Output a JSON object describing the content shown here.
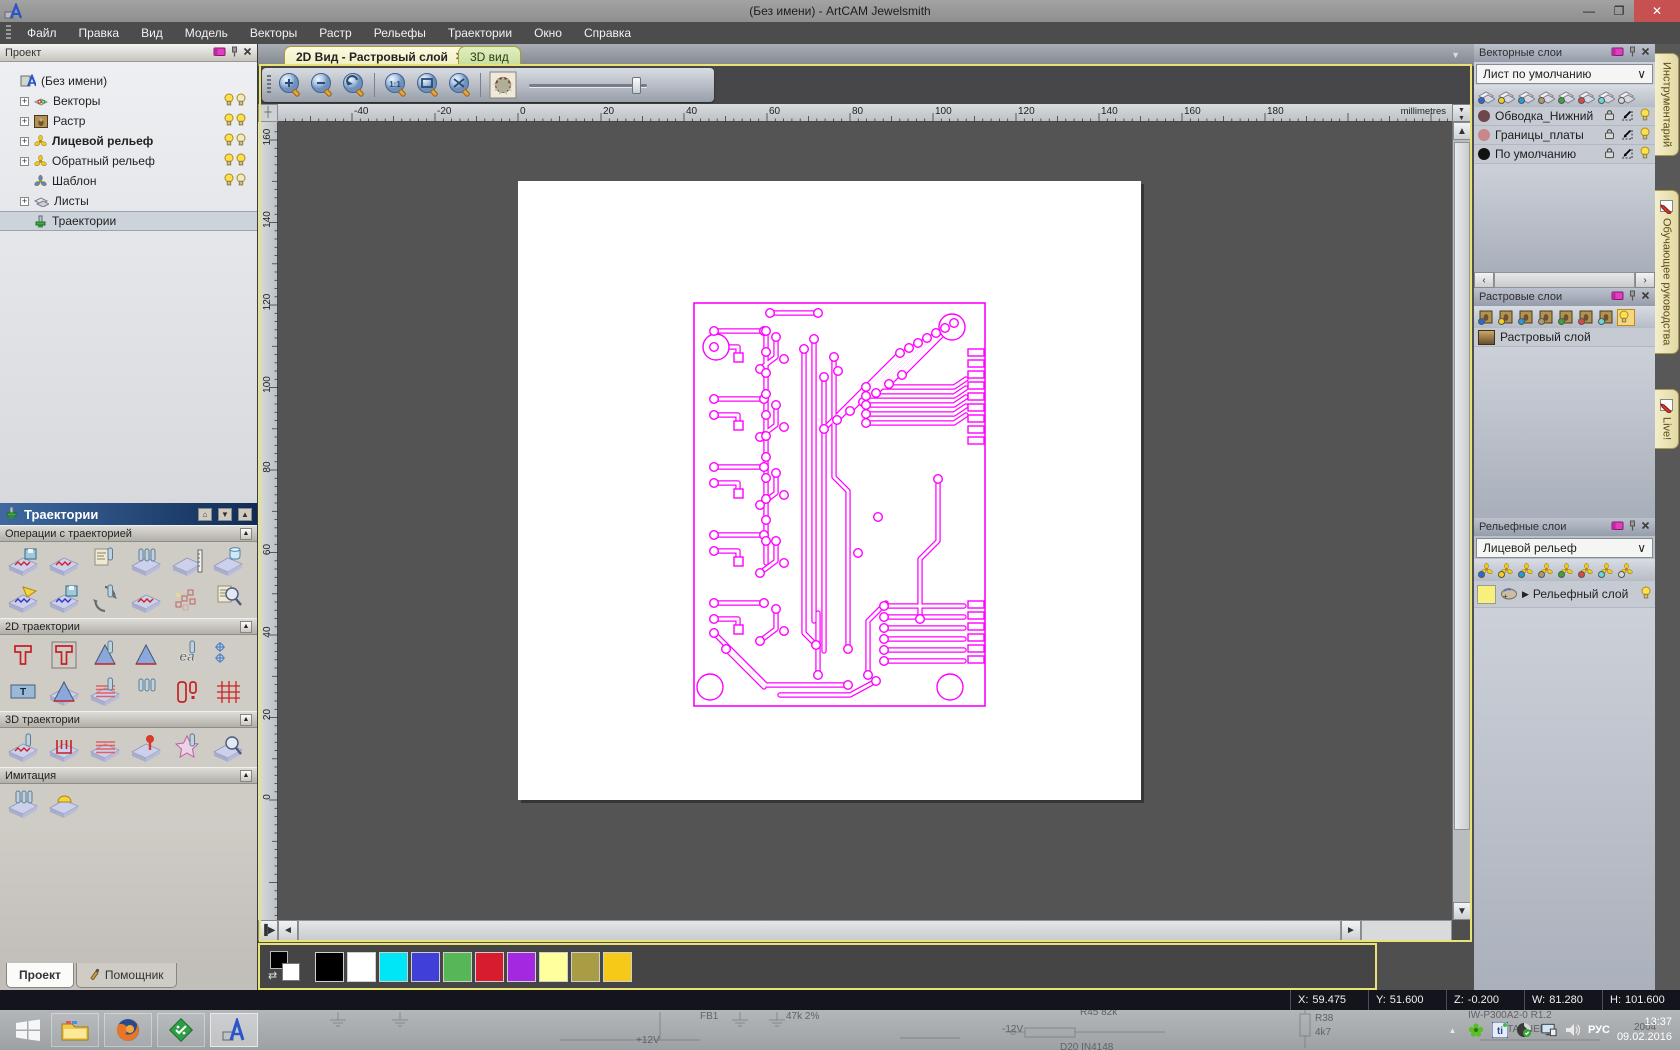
{
  "window": {
    "title": "(Без имени) - ArtCAM Jewelsmith"
  },
  "menu": {
    "items": [
      "Файл",
      "Правка",
      "Вид",
      "Модель",
      "Векторы",
      "Растр",
      "Рельефы",
      "Траектории",
      "Окно",
      "Справка"
    ]
  },
  "project_panel": {
    "title": "Проект",
    "tree": [
      {
        "label": "(Без имени)",
        "icon": "artcam-model-icon",
        "plus": false,
        "bulb": false,
        "indent": 0,
        "bold": false,
        "selected": false
      },
      {
        "label": "Векторы",
        "icon": "vectors-icon",
        "plus": true,
        "bulb": true,
        "indent": 1,
        "bold": false,
        "selected": false
      },
      {
        "label": "Растр",
        "icon": "monalisa-icon",
        "plus": true,
        "bulb": true,
        "indent": 1,
        "bold": false,
        "selected": false
      },
      {
        "label": "Лицевой рельеф",
        "icon": "relief-flower-icon",
        "plus": true,
        "bulb": true,
        "indent": 1,
        "bold": true,
        "selected": false
      },
      {
        "label": "Обратный рельеф",
        "icon": "relief-flower-icon",
        "plus": true,
        "bulb": true,
        "indent": 1,
        "bold": false,
        "selected": false
      },
      {
        "label": "Шаблон",
        "icon": "template-flower-icon",
        "plus": false,
        "bulb": true,
        "indent": 1,
        "bold": false,
        "selected": false
      },
      {
        "label": "Листы",
        "icon": "sheets-icon",
        "plus": true,
        "bulb": false,
        "indent": 1,
        "bold": false,
        "selected": false
      },
      {
        "label": "Траектории",
        "icon": "toolpath-icon",
        "plus": false,
        "bulb": false,
        "indent": 1,
        "bold": false,
        "selected": true
      }
    ]
  },
  "toolpaths_panel": {
    "title": "Траектории",
    "sections": [
      {
        "title": "Операции с траекторией",
        "icons": [
          "save-toolpath",
          "toolpath-blocks",
          "toolpath-calculator",
          "batch-drills",
          "material-block",
          "delete-toolpath",
          "toolpath-fold",
          "save-toolpath-blue",
          "transform-toolpath",
          "flat-toolpath",
          "nesting-dots",
          "toolpath-preview"
        ]
      },
      {
        "title": "2D траектории",
        "icons": [
          "profile-toolpath",
          "area-clearance",
          "v-bit-carving",
          "bevel-carving",
          "engraving-ea",
          "drilling",
          "text-plate",
          "wedge-milling",
          "texture-toolpath",
          "multi-drill",
          "inlay-toolpath",
          "grid-toolpath"
        ]
      },
      {
        "title": "3D траектории",
        "icons": [
          "roughing-3d",
          "z-level-pocket",
          "slice-relief",
          "cast-simulation",
          "star-machining",
          "toolpath-inspect"
        ]
      },
      {
        "title": "Имитация",
        "icons": [
          "simulate-toolpath",
          "simulation-control"
        ]
      }
    ]
  },
  "bottom_tabs": {
    "project": "Проект",
    "assistant": "Помощник"
  },
  "view": {
    "tabs": [
      {
        "label": "2D Вид - Растровый слой"
      },
      {
        "label": "3D вид"
      }
    ],
    "ruler_unit": "millimetres",
    "ruler_h_labels": [
      "-40",
      "-20",
      "0",
      "20",
      "40",
      "60",
      "80",
      "100",
      "120",
      "140",
      "160",
      "180"
    ],
    "ruler_v_labels": [
      "0",
      "20",
      "40",
      "60",
      "80",
      "100",
      "120",
      "140",
      "160"
    ]
  },
  "vector_layers": {
    "title": "Векторные слои",
    "sheet": "Лист по умолчанию",
    "layers": [
      {
        "name": "Обводка_Нижний",
        "color": "#6e474b"
      },
      {
        "name": "Границы_платы",
        "color": "#c9878b"
      },
      {
        "name": "По умолчанию",
        "color": "#121212"
      }
    ]
  },
  "bitmap_layers": {
    "title": "Растровые слои",
    "layers": [
      {
        "name": "Растровый слой"
      }
    ]
  },
  "relief_layers": {
    "title": "Рельефные слои",
    "selected": "Лицевой рельеф",
    "layers": [
      {
        "name": "Рельефный слой",
        "color": "#f7f07c"
      }
    ]
  },
  "side_tabs": [
    "Инструментарий",
    "Обучающее руководства",
    "Live!"
  ],
  "palette": {
    "colors": [
      "#000000",
      "#ffffff",
      "#00e6f6",
      "#4040d8",
      "#57b757",
      "#d81c30",
      "#a428e0",
      "#ffff9c",
      "#a89c44",
      "#f6c818"
    ]
  },
  "status_bar": {
    "fields": [
      {
        "label": "X:",
        "value": "59.475"
      },
      {
        "label": "Y:",
        "value": "51.600"
      },
      {
        "label": "Z:",
        "value": "-0.200"
      },
      {
        "label": "W:",
        "value": "81.280"
      },
      {
        "label": "H:",
        "value": "101.600"
      }
    ]
  },
  "taskbar": {
    "tray": {
      "lang": "РУС",
      "time": "13:37",
      "date": "09.02.2016"
    },
    "wallpaper_labels": [
      "FB1",
      "47k  2%",
      "-12V",
      "+12V",
      "R45   82k",
      "D20  IN4148",
      "R38",
      "4k7",
      "IW-P300A2-0 R1.2",
      "DATASHEET",
      "2004"
    ]
  },
  "pcb": {
    "trace_color": "#ff00ff"
  }
}
